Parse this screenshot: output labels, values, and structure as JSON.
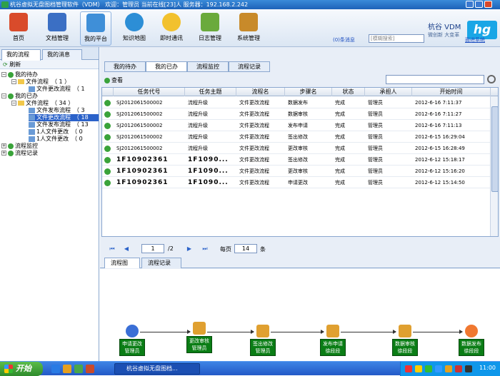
{
  "window": {
    "title": "杭谷虚拟无盘图档管理软件（VDM） 欢迎：管理员 当前在线[23]人 服务器：192.168.2.242"
  },
  "toolbar": {
    "items": [
      {
        "label": "首页",
        "icon": "home-icon",
        "color": "#d94b2b"
      },
      {
        "label": "文档管理",
        "icon": "books-icon",
        "color": "#3b6fc4"
      },
      {
        "label": "我的平台",
        "icon": "platform-icon",
        "color": "#3f8fd8"
      },
      {
        "label": "知识地图",
        "icon": "globe-icon",
        "color": "#2c8ed6"
      },
      {
        "label": "即时通讯",
        "icon": "chat-icon",
        "color": "#f2c12e"
      },
      {
        "label": "日志管理",
        "icon": "notebook-icon",
        "color": "#6aaa3c"
      },
      {
        "label": "系统管理",
        "icon": "gears-icon",
        "color": "#c88a2a"
      }
    ],
    "brand_title": "杭谷 VDM",
    "brand_sub": "微创新 大变革",
    "logo_text": "hg",
    "messages": "(0)条消息",
    "search_placeholder": "[模糊搜索]",
    "logout": "面进系统"
  },
  "left": {
    "tabs": [
      "我的流程",
      "我的消息"
    ],
    "refresh": "刷新",
    "tree": [
      {
        "label": "我的待办",
        "level": 0,
        "type": "green"
      },
      {
        "label": "文件流程　（ 1 ）",
        "level": 1,
        "type": "folder"
      },
      {
        "label": "文件更改流程　（ 1",
        "level": 2,
        "type": "doc"
      },
      {
        "label": "我的已办",
        "level": 0,
        "type": "green"
      },
      {
        "label": "文件流程　（ 34 ）",
        "level": 1,
        "type": "folder"
      },
      {
        "label": "文件发布流程　（ 3",
        "level": 2,
        "type": "doc"
      },
      {
        "label": "文件更改流程　（ 18",
        "level": 2,
        "type": "doc",
        "selected": true
      },
      {
        "label": "文件发布流程　（ 13",
        "level": 2,
        "type": "doc"
      },
      {
        "label": "1人文件更改　（ 0",
        "level": 2,
        "type": "doc"
      },
      {
        "label": "1人文件更改　（ 0",
        "level": 2,
        "type": "doc"
      },
      {
        "label": "流程监控",
        "level": 0,
        "type": "green"
      },
      {
        "label": "流程记录",
        "level": 0,
        "type": "green"
      }
    ]
  },
  "main": {
    "tabs": [
      "我的待办",
      "我的已办",
      "流程监控",
      "流程记录"
    ],
    "view_button": "查看",
    "columns": [
      "任务代号",
      "任务主题",
      "流程名",
      "步骤名",
      "状态",
      "承担人",
      "开始时间"
    ],
    "rows": [
      [
        "SJ2012061500002",
        "流程升级",
        "文件更改流程",
        "数据发布",
        "完成",
        "管理员",
        "2012-6-16 7:11:37"
      ],
      [
        "SJ2012061500002",
        "流程升级",
        "文件更改流程",
        "数据审核",
        "完成",
        "管理员",
        "2012-6-16 7:11:27"
      ],
      [
        "SJ2012061500002",
        "流程升级",
        "文件更改流程",
        "发布申请",
        "完成",
        "管理员",
        "2012-6-16 7:11:13"
      ],
      [
        "SJ2012061500002",
        "流程升级",
        "文件更改流程",
        "签出修改",
        "完成",
        "管理员",
        "2012-6-15 16:29:04"
      ],
      [
        "SJ2012061500002",
        "流程升级",
        "文件更改流程",
        "更改审核",
        "完成",
        "管理员",
        "2012-6-15 16:28:49"
      ],
      [
        "1F10902361",
        "1F1090...",
        "文件更改流程",
        "签出修改",
        "完成",
        "管理员",
        "2012-6-12 15:18:17"
      ],
      [
        "1F10902361",
        "1F1090...",
        "文件更改流程",
        "更改审核",
        "完成",
        "管理员",
        "2012-6-12 15:16:20"
      ],
      [
        "1F10902361",
        "1F1090...",
        "文件更改流程",
        "申请更改",
        "完成",
        "管理员",
        "2012-6-12 15:14:50"
      ]
    ],
    "pager": {
      "page": "1",
      "total": "/2",
      "per_page_label": "每页",
      "per_page": "14",
      "unit": "条"
    },
    "bottom_tabs": [
      "流程图",
      "流程记录"
    ],
    "flow": [
      {
        "step": "申请更改",
        "who": "管理员",
        "icon": "start-icon"
      },
      {
        "step": "更改审核",
        "who": "管理员",
        "icon": "users-icon"
      },
      {
        "step": "签出修改",
        "who": "管理员",
        "icon": "users-icon"
      },
      {
        "step": "发布申请",
        "who": "徐段段",
        "icon": "users-icon"
      },
      {
        "step": "数据审核",
        "who": "徐段段",
        "icon": "users-icon"
      },
      {
        "step": "数据发布",
        "who": "徐段段",
        "icon": "stop-icon"
      }
    ]
  },
  "taskbar": {
    "start": "开始",
    "task": "杭谷虚拟无盘图档...",
    "clock": "11:00"
  }
}
